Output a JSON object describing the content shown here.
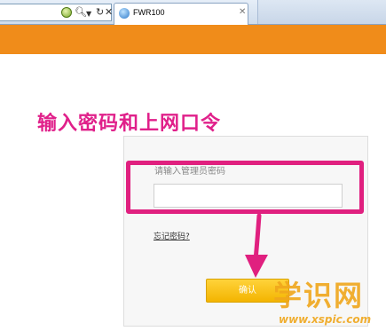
{
  "browser": {
    "tab_title": "FWR100",
    "toolbar_icons": [
      "go-icon",
      "search-icon",
      "dropdown-icon",
      "refresh-icon",
      "close-icon"
    ]
  },
  "annotation": {
    "caption": "输入密码和上网口令",
    "highlight_color": "#e0207f"
  },
  "login": {
    "password_label": "请输入管理员密码",
    "password_value": "",
    "forgot_link": "忘记密码?",
    "confirm_label": "确认"
  },
  "header": {
    "color": "#f08c1a"
  },
  "watermark": {
    "main": "学识网",
    "url": "www.xspic.com"
  }
}
